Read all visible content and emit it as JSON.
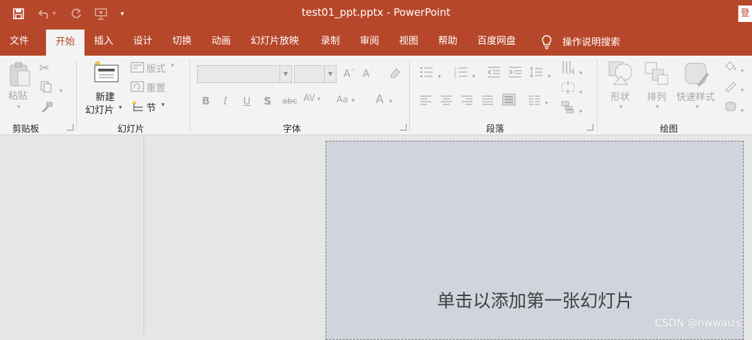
{
  "window": {
    "title": "test01_ppt.pptx  -  PowerPoint",
    "login_label": "登"
  },
  "tabs": [
    {
      "label": "文件"
    },
    {
      "label": "开始",
      "active": true
    },
    {
      "label": "插入"
    },
    {
      "label": "设计"
    },
    {
      "label": "切换"
    },
    {
      "label": "动画"
    },
    {
      "label": "幻灯片放映"
    },
    {
      "label": "录制"
    },
    {
      "label": "审阅"
    },
    {
      "label": "视图"
    },
    {
      "label": "帮助"
    },
    {
      "label": "百度网盘"
    }
  ],
  "search_tab": {
    "label": "操作说明搜索",
    "icon": "lightbulb-icon"
  },
  "ribbon": {
    "clipboard": {
      "group_label": "剪贴板",
      "paste_label": "粘贴"
    },
    "slides": {
      "group_label": "幻灯片",
      "new_slide_line1": "新建",
      "new_slide_line2": "幻灯片",
      "layout_label": "版式",
      "reset_label": "重置",
      "section_label": "节"
    },
    "font": {
      "group_label": "字体"
    },
    "paragraph": {
      "group_label": "段落"
    },
    "drawing": {
      "group_label": "绘图",
      "shapes_label": "形状",
      "arrange_label": "排列",
      "quick_styles_label": "快速样式"
    }
  },
  "slide": {
    "placeholder": "单击以添加第一张幻灯片"
  },
  "watermark": "CSDN @hwwaizs",
  "colors": {
    "accent": "#b7472a",
    "ribbon_bg": "#f3f3f3",
    "slide_bg": "#d0d4dc"
  }
}
